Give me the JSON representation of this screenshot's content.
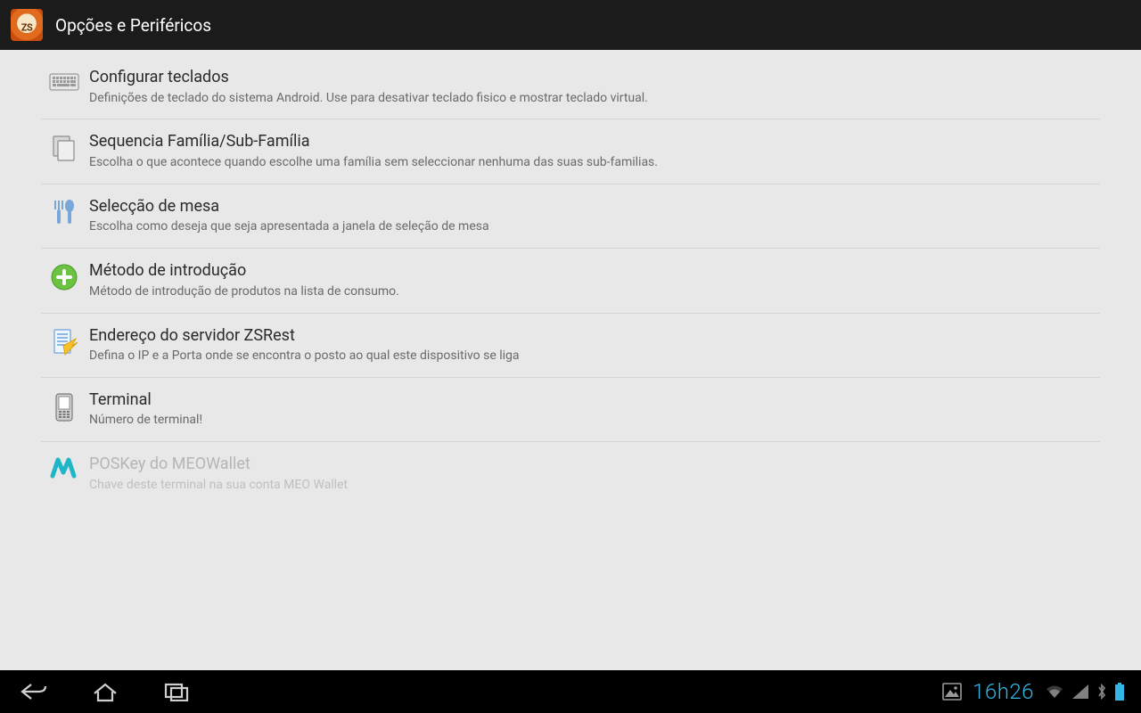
{
  "header": {
    "title": "Opções e Periféricos"
  },
  "prefs": [
    {
      "icon": "keyboard",
      "title": "Configurar teclados",
      "sub": "Definições de teclado do sistema Android. Use para desativar teclado fisico e mostrar teclado virtual.",
      "disabled": false
    },
    {
      "icon": "copy",
      "title": "Sequencia Família/Sub-Família",
      "sub": "Escolha o que acontece quando escolhe uma família sem seleccionar nenhuma das suas sub-familias.",
      "disabled": false
    },
    {
      "icon": "cutlery",
      "title": "Selecção de mesa",
      "sub": "Escolha como deseja que seja apresentada a janela de seleção de mesa",
      "disabled": false
    },
    {
      "icon": "plus",
      "title": "Método de introdução",
      "sub": "Método de introdução de produtos na lista de consumo.",
      "disabled": false
    },
    {
      "icon": "server",
      "title": "Endereço do servidor ZSRest",
      "sub": "Defina o IP e a Porta onde se encontra o posto ao qual este dispositivo se liga",
      "disabled": false
    },
    {
      "icon": "terminal",
      "title": "Terminal",
      "sub": "Número de terminal!",
      "disabled": false
    },
    {
      "icon": "wallet",
      "title": "POSKey do MEOWallet",
      "sub": "Chave deste terminal na sua conta MEO Wallet",
      "disabled": true
    }
  ],
  "statusbar": {
    "time": "16h26"
  }
}
